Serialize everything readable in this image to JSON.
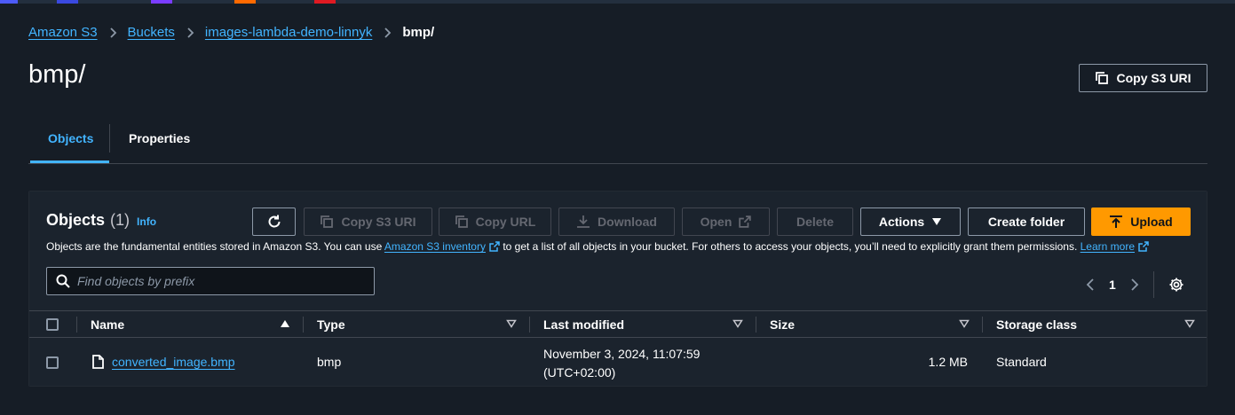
{
  "colors": {
    "background": "#161d26",
    "link": "#42b4ff",
    "primary_button": "#ff9900",
    "top_bar_segments": [
      "#4d5bf9",
      "#3a49e0",
      "#7a3cff",
      "#ff6a00",
      "#e01a22"
    ]
  },
  "breadcrumb": {
    "items": [
      "Amazon S3",
      "Buckets",
      "images-lambda-demo-linnyk"
    ],
    "current": "bmp/",
    "separator_icon": "chevron-right-icon"
  },
  "header": {
    "title": "bmp/",
    "copy_uri_label": "Copy S3 URI",
    "copy_icon": "copy-icon"
  },
  "tabs": [
    {
      "label": "Objects",
      "active": true
    },
    {
      "label": "Properties",
      "active": false
    }
  ],
  "objects_panel": {
    "title": "Objects",
    "count": "(1)",
    "info_label": "Info",
    "description_before": "Objects are the fundamental entities stored in Amazon S3. You can use ",
    "inventory_link": "Amazon S3 inventory",
    "description_middle": " to get a list of all objects in your bucket. For others to access your objects, you’ll need to explicitly grant them permissions. ",
    "learn_more": "Learn more",
    "toolbar": {
      "refresh_icon": "refresh-icon",
      "copy_s3_uri": "Copy S3 URI",
      "copy_url": "Copy URL",
      "download": "Download",
      "open": "Open",
      "delete": "Delete",
      "actions": "Actions",
      "create_folder": "Create folder",
      "upload": "Upload"
    },
    "search": {
      "placeholder": "Find objects by prefix",
      "value": ""
    },
    "pagination": {
      "current_page": "1"
    },
    "table": {
      "columns": [
        "Name",
        "Type",
        "Last modified",
        "Size",
        "Storage class"
      ],
      "rows": [
        {
          "name": "converted_image.bmp",
          "type": "bmp",
          "last_modified_line1": "November 3, 2024, 11:07:59",
          "last_modified_line2": "(UTC+02:00)",
          "size": "1.2 MB",
          "storage_class": "Standard",
          "icon": "file-icon"
        }
      ]
    }
  }
}
